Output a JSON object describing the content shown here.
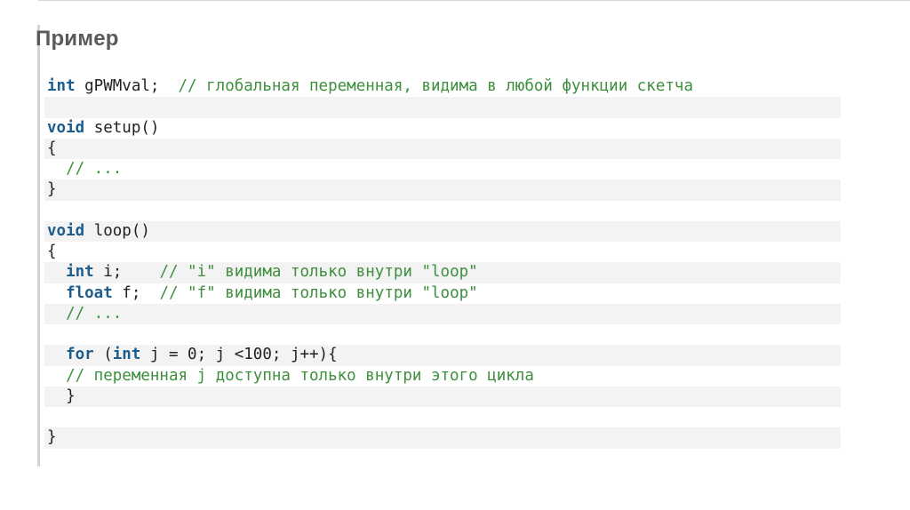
{
  "title": "Пример",
  "code": {
    "lines": [
      [
        {
          "t": "int",
          "c": "kw"
        },
        {
          "t": " gPWMval;  ",
          "c": "pl"
        },
        {
          "t": "// глобальная переменная, видима в любой функции скетча",
          "c": "cm"
        }
      ],
      [],
      [
        {
          "t": "void",
          "c": "kw"
        },
        {
          "t": " setup()",
          "c": "pl"
        }
      ],
      [
        {
          "t": "{",
          "c": "pl"
        }
      ],
      [
        {
          "t": "  ",
          "c": "pl"
        },
        {
          "t": "// ...",
          "c": "cm"
        }
      ],
      [
        {
          "t": "}",
          "c": "pl"
        }
      ],
      [],
      [
        {
          "t": "void",
          "c": "kw"
        },
        {
          "t": " loop()",
          "c": "pl"
        }
      ],
      [
        {
          "t": "{",
          "c": "pl"
        }
      ],
      [
        {
          "t": "  ",
          "c": "pl"
        },
        {
          "t": "int",
          "c": "kw"
        },
        {
          "t": " i;    ",
          "c": "pl"
        },
        {
          "t": "// \"i\" видима только внутри \"loop\"",
          "c": "cm"
        }
      ],
      [
        {
          "t": "  ",
          "c": "pl"
        },
        {
          "t": "float",
          "c": "kw"
        },
        {
          "t": " f;  ",
          "c": "pl"
        },
        {
          "t": "// \"f\" видима только внутри \"loop\"",
          "c": "cm"
        }
      ],
      [
        {
          "t": "  ",
          "c": "pl"
        },
        {
          "t": "// ...",
          "c": "cm"
        }
      ],
      [],
      [
        {
          "t": "  ",
          "c": "pl"
        },
        {
          "t": "for",
          "c": "kw"
        },
        {
          "t": " (",
          "c": "pl"
        },
        {
          "t": "int",
          "c": "kw"
        },
        {
          "t": " j = 0; j <100; j++){",
          "c": "pl"
        }
      ],
      [
        {
          "t": "  ",
          "c": "pl"
        },
        {
          "t": "// переменная j доступна только внутри этого цикла",
          "c": "cm"
        }
      ],
      [
        {
          "t": "  }",
          "c": "pl"
        }
      ],
      [],
      [
        {
          "t": "}",
          "c": "pl"
        }
      ]
    ]
  },
  "colors": {
    "keyword": "#1d5d8e",
    "comment": "#3d8f3d",
    "plain": "#222222",
    "stripe": "#f3f3f3",
    "title": "#5a5a5a"
  }
}
